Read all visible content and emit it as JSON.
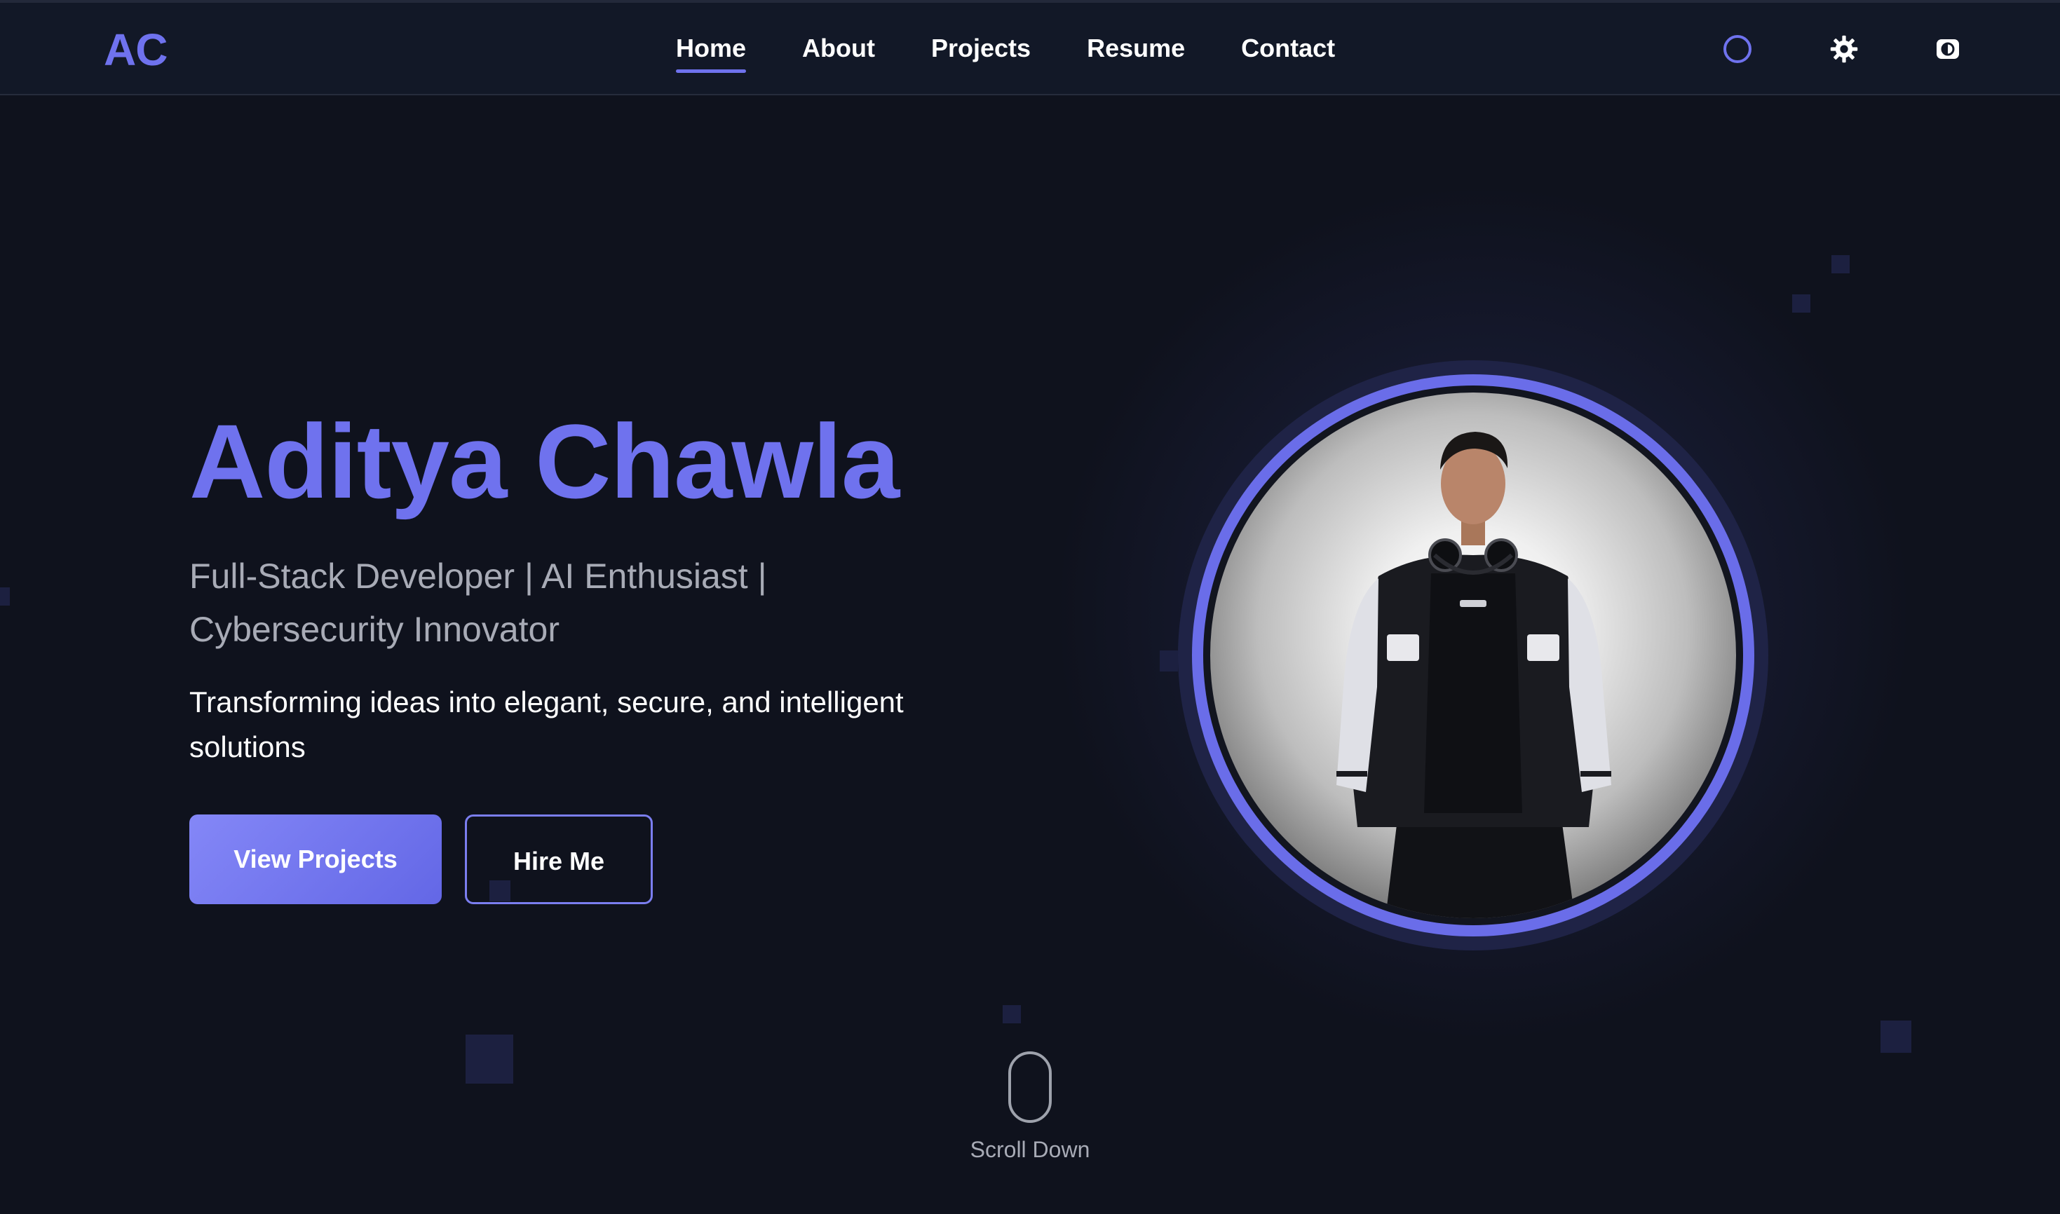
{
  "nav": {
    "logo": "AC",
    "links": [
      {
        "label": "Home",
        "active": true
      },
      {
        "label": "About",
        "active": false
      },
      {
        "label": "Projects",
        "active": false
      },
      {
        "label": "Resume",
        "active": false
      },
      {
        "label": "Contact",
        "active": false
      }
    ],
    "icons": [
      "ring-icon",
      "gear-icon",
      "contrast-icon"
    ]
  },
  "hero": {
    "name": "Aditya Chawla",
    "subtitle": "Full-Stack Developer | AI Enthusiast | Cybersecurity Innovator",
    "tagline": "Transforming ideas into elegant, secure, and intelligent solutions",
    "primary_button": "View Projects",
    "secondary_button": "Hire Me"
  },
  "scroll": {
    "label": "Scroll Down"
  },
  "colors": {
    "accent": "#6f72ee",
    "background": "#0f121d",
    "nav_background": "#121827",
    "muted_text": "#a8abb6"
  }
}
